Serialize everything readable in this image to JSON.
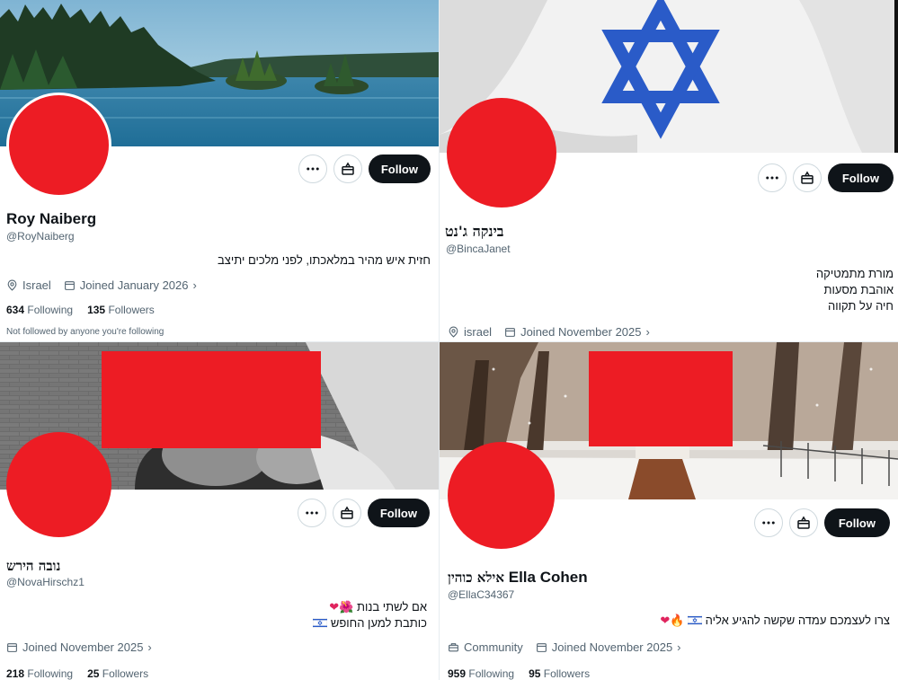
{
  "profiles": [
    {
      "name": "Roy Naiberg",
      "handle": "@RoyNaiberg",
      "bio_lines": [
        "חזית איש מהיר במלאכתו, לפני מלכים יתיצב"
      ],
      "location": "Israel",
      "joined": "Joined January 2026",
      "following_count": "634",
      "following_label": "Following",
      "followers_count": "135",
      "followers_label": "Followers",
      "note": "Not followed by anyone you're following",
      "follow_label": "Follow",
      "banner": "lake-with-islands"
    },
    {
      "name": "בינקה ג'נט",
      "handle": "@BincaJanet",
      "bio_lines": [
        "מורת מתמטיקה",
        "אוהבת מסעות",
        "חיה על תקווה"
      ],
      "location": "israel",
      "joined": "Joined November 2025",
      "follow_label": "Follow",
      "banner": "israel-flag"
    },
    {
      "name": "נובה הירש",
      "handle": "@NovaHirschz1",
      "bio_line1": "אם לשתי בנות",
      "bio_line2": "כותבת למען החופש",
      "joined": "Joined November 2025",
      "following_count": "218",
      "following_label": "Following",
      "followers_count": "25",
      "followers_label": "Followers",
      "follow_label": "Follow",
      "banner": "black-and-white-photo"
    },
    {
      "name_hebrew": "אילא כוהין",
      "name_latin": "Ella Cohen",
      "handle": "@EllaC34367",
      "bio": "צרו לעצמכם עמדה שקשה להגיע אליה",
      "community": "Community",
      "joined": "Joined November 2025",
      "following_count": "959",
      "following_label": "Following",
      "followers_count": "95",
      "followers_label": "Followers",
      "follow_label": "Follow",
      "banner": "snowy-forest"
    }
  ],
  "colors": {
    "redaction": "#ed1c24",
    "follow_button": "#0f1419",
    "secondary_text": "#536471",
    "flag_blue": "#2a5bc8"
  }
}
